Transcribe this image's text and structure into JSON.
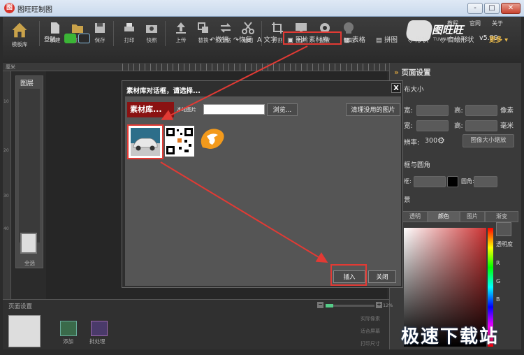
{
  "window": {
    "title": "图旺旺制图",
    "app_icon": "图",
    "controls": [
      "-",
      "□",
      "✕"
    ]
  },
  "toolbar": {
    "tools": [
      {
        "label": "模板库",
        "icon": "house-icon"
      },
      {
        "label": "新建",
        "icon": "new-file-icon"
      },
      {
        "label": "打开",
        "icon": "folder-icon"
      },
      {
        "label": "保存",
        "icon": "save-icon"
      },
      {
        "label": "打印",
        "icon": "printer-icon"
      },
      {
        "label": "快照",
        "icon": "camera-icon"
      },
      {
        "label": "上传",
        "icon": "upload-icon"
      },
      {
        "label": "替换",
        "icon": "replace-icon"
      },
      {
        "label": "压缩",
        "icon": "compress-icon"
      },
      {
        "label": "裁切",
        "icon": "scissors-icon"
      },
      {
        "label": "分割",
        "icon": "crop-icon"
      },
      {
        "label": "全屏",
        "icon": "monitor-icon"
      },
      {
        "label": "配置",
        "icon": "gear-icon"
      },
      {
        "label": "帮助",
        "icon": "help-icon"
      }
    ],
    "top_links": [
      "教程",
      "官网",
      "关于"
    ],
    "logo": {
      "main": "图旺旺",
      "sub": "TUWANGWANG",
      "version": "v5.99"
    }
  },
  "row2": {
    "login_label": "登陆:",
    "undo": "撤销",
    "redo": "恢复",
    "insert_tools": [
      {
        "label": "文字",
        "icon": "text-icon"
      },
      {
        "label": "图片素材库",
        "icon": "image-icon"
      },
      {
        "label": "表格",
        "icon": "table-icon"
      },
      {
        "label": "拼图",
        "icon": "puzzle-icon"
      },
      {
        "label": "形状",
        "icon": "shape-icon"
      },
      {
        "label": "自绘形状",
        "icon": "draw-shape-icon"
      }
    ],
    "more": "更多 ▾"
  },
  "ruler": {
    "unit": "厘米",
    "marks": [
      "10",
      "20",
      "30",
      "40"
    ]
  },
  "layers": {
    "title": "图层",
    "select_all": "全选"
  },
  "right_panel": {
    "title": "页面设置",
    "canvas_size": "布大小",
    "width_label": "宽:",
    "height_label": "高:",
    "unit_px": "像素",
    "unit_mm": "毫米",
    "resolution_label": "辨率:",
    "resolution_value": "300",
    "scale_button": "图像大小缩放",
    "border_section": "框与圆角",
    "border_label": "框:",
    "radius_label": "圆角:",
    "bg_section": "景",
    "bg_tabs": [
      "透明",
      "颜色",
      "图片",
      "渐变"
    ],
    "opacity_label": "透明度",
    "channels": [
      "R",
      "G",
      "B"
    ]
  },
  "bottom": {
    "title": "页面设置",
    "zoom_percent": "12%",
    "zoom_level": 0.15,
    "add_label": "添加",
    "batch_label": "批处理",
    "side_labels": [
      "实际像素",
      "适合屏幕",
      "打印尺寸"
    ]
  },
  "dialog": {
    "title": "素材库对话框，请选择...",
    "close_x": "X",
    "library_label": "素材库...",
    "local_label": "本地图片",
    "path_value": "",
    "browse": "浏览...",
    "clean": "清理没用的图片",
    "insert": "插入",
    "close": "关闭",
    "items": [
      {
        "name": "car-photo"
      },
      {
        "name": "qr-code"
      },
      {
        "name": "app-logo"
      }
    ]
  },
  "watermark": {
    "text": "极速下载站"
  },
  "colors": {
    "highlight": "#e23a34",
    "panel": "#3a3a3a",
    "dialog": "#555555"
  }
}
